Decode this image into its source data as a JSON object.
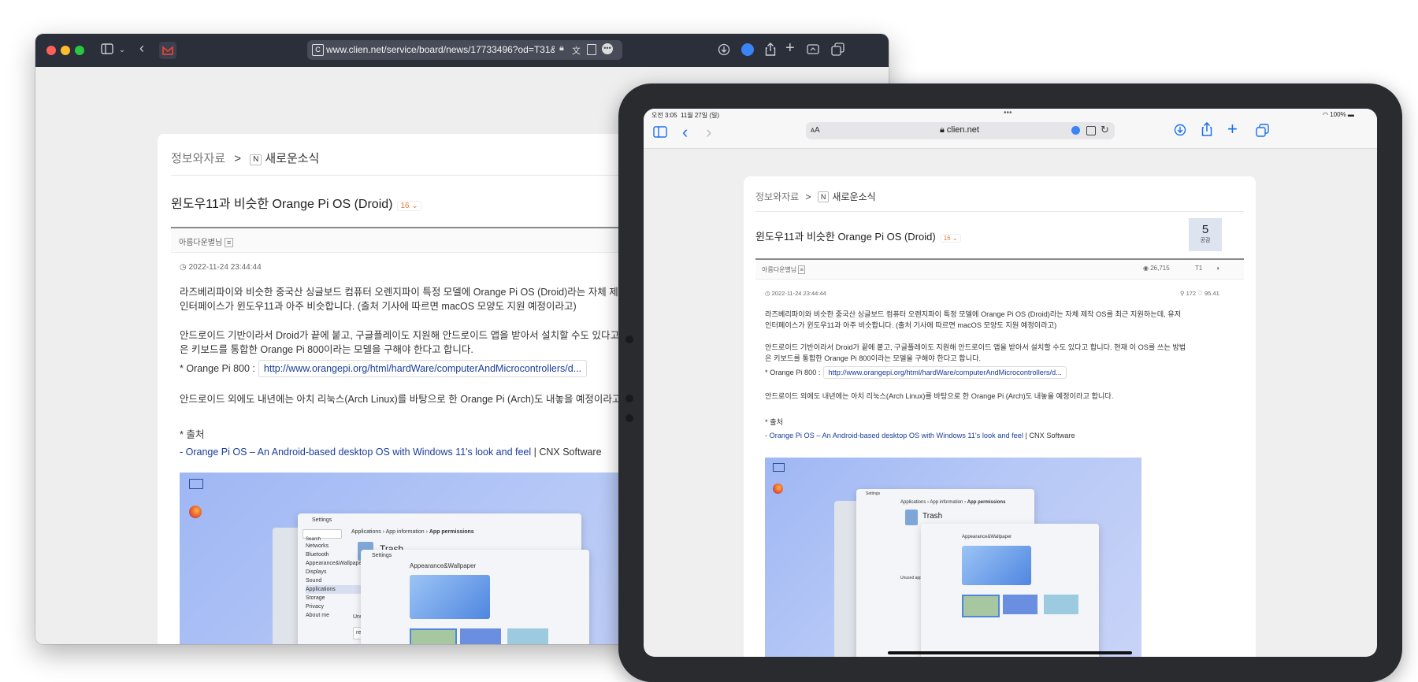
{
  "mac": {
    "url": "www.clien.net/service/board/news/17733496?od=T31&",
    "toolbar_icons": [
      "sidebar-icon",
      "chevron-down-icon",
      "back-icon",
      "gmail-tab-icon"
    ],
    "right_icons": [
      "download-icon",
      "extension-icon",
      "share-icon",
      "new-tab-icon",
      "screen-icon",
      "tabs-icon"
    ]
  },
  "article": {
    "breadcrumb_root": "정보와자료",
    "breadcrumb_sep": ">",
    "breadcrumb_badge": "N",
    "breadcrumb_board": "새로운소식",
    "title": "윈도우11과 비슷한 Orange Pi OS (Droid)",
    "comment_count": "16",
    "author": "아름다운별님",
    "date": "2022-11-24 23:44:44",
    "p1_line1": "라즈베리파이와 비슷한 중국산 싱글보드 컴퓨터 오렌지파이 특정 모델에 Orange Pi OS (Droid)라는 자체 제작 OS를 최근 지원하는데, 유저",
    "p1_line2": "인터페이스가 윈도우11과 아주 비슷합니다. (출처 기사에 따르면 macOS 모양도 지원 예정이라고)",
    "p2_line1": "안드로이드 기반이라서 Droid가 끝에 붙고, 구글플레이도 지원해 안드로이드 앱을 받아서 설치할 수도 있다고 합니다. 현재 이 OS를 쓰는 방법",
    "p2_line2": "은 키보드를 통합한 Orange Pi 800이라는 모델을 구해야 한다고 합니다.",
    "link_label": "* Orange Pi 800 :",
    "link_url": "http://www.orangepi.org/html/hardWare/computerAndMicrocontrollers/d...",
    "p3": "안드로이드 외에도 내년에는 아치 리눅스(Arch Linux)를 바탕으로 한 Orange Pi (Arch)도 내놓을 예정이라고 합니다.",
    "source_label": "* 출처",
    "source_link": "- Orange Pi OS – An Android-based desktop OS with Windows 11's look and feel",
    "source_suffix": " | CNX Software",
    "likes": "5",
    "likes_label": "공감",
    "views": "26,715",
    "font_btn": "T1",
    "ip_info": "172 ♡ 95.41"
  },
  "screenshot": {
    "settings": "Settings",
    "search": "Search",
    "crumb_apps": "Applications",
    "crumb_info": "App information",
    "crumb_perm": "App permissions",
    "trash": "Trash",
    "appearance": "Appearance&Wallpaper",
    "unused": "Unused apps",
    "revoke": "revoke pe",
    "nav": [
      "Networks",
      "Bluetooth",
      "Appearance&Wallpaper",
      "Displays",
      "Sound",
      "Applications",
      "Storage",
      "Privacy",
      "About me"
    ]
  },
  "ipad": {
    "time": "오전 3:05",
    "date": "11월 27일 (일)",
    "battery": "100%",
    "domain": "clien.net",
    "text_size": "ᴀA"
  },
  "colors": {
    "accent": "#1c6ef2",
    "link": "#1a3d99",
    "comment": "#e9793a"
  }
}
